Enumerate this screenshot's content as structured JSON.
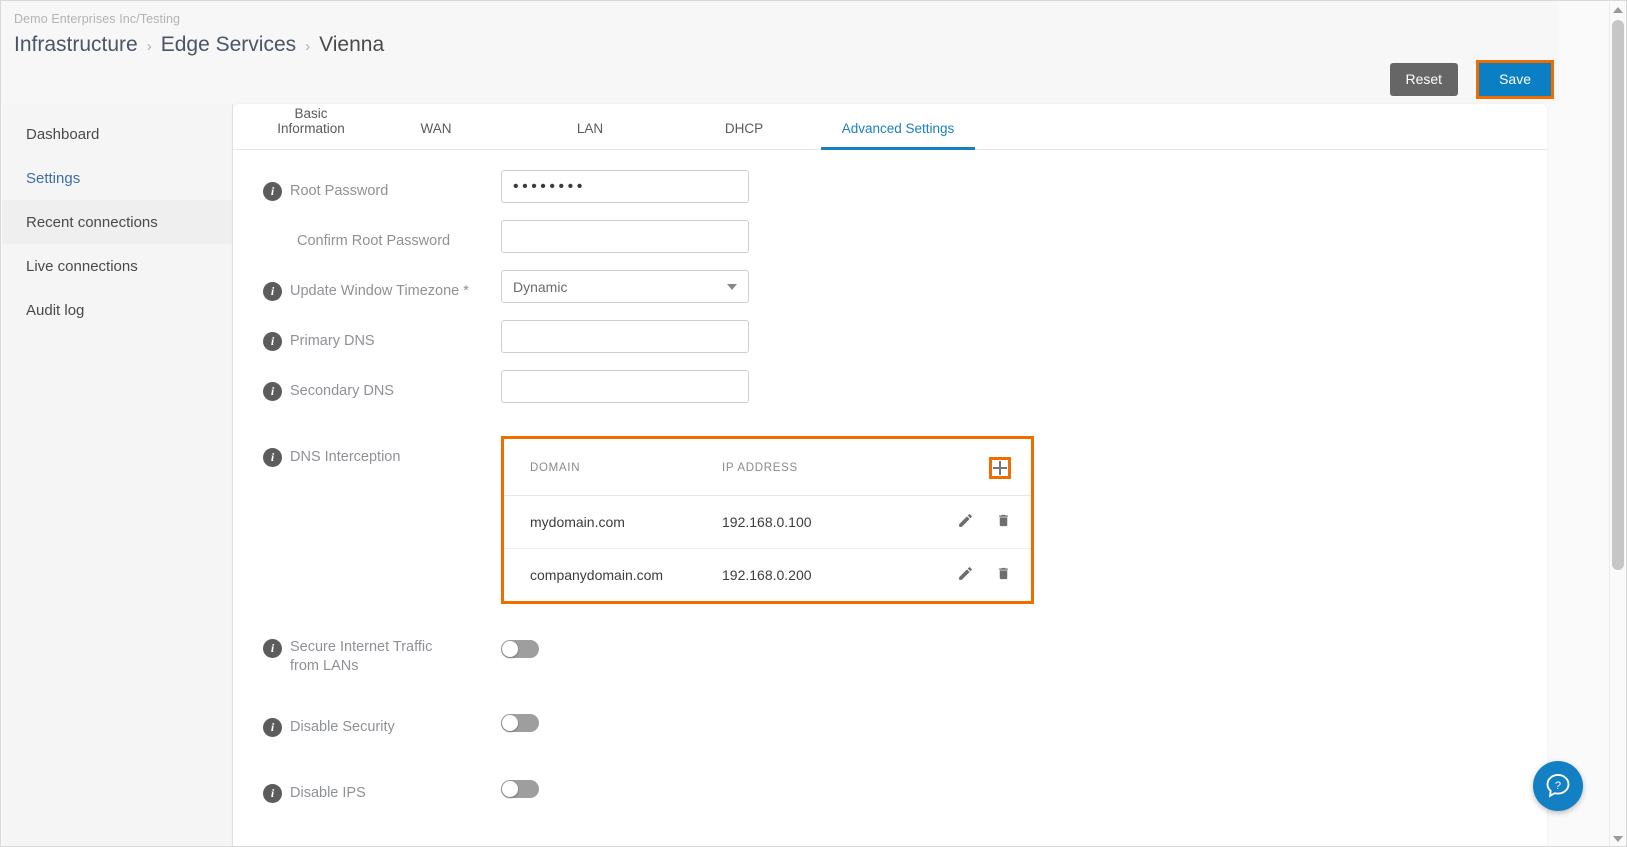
{
  "header": {
    "org": "Demo Enterprises Inc/Testing",
    "breadcrumb": [
      {
        "label": "Infrastructure",
        "type": "link"
      },
      {
        "label": "Edge Services",
        "type": "link"
      },
      {
        "label": "Vienna",
        "type": "current"
      }
    ],
    "separator": "›",
    "reset_label": "Reset",
    "save_label": "Save"
  },
  "sidebar": {
    "items": [
      {
        "label": "Dashboard",
        "state": "default"
      },
      {
        "label": "Settings",
        "state": "active-link"
      },
      {
        "label": "Recent connections",
        "state": "hovered"
      },
      {
        "label": "Live connections",
        "state": "default"
      },
      {
        "label": "Audit log",
        "state": "default"
      }
    ]
  },
  "tabs": [
    {
      "label": "Basic Information",
      "active": false
    },
    {
      "label": "WAN",
      "active": false
    },
    {
      "label": "LAN",
      "active": false
    },
    {
      "label": "DHCP",
      "active": false
    },
    {
      "label": "Advanced Settings",
      "active": true
    }
  ],
  "form": {
    "root_password": {
      "label": "Root Password",
      "value": "••••••••",
      "placeholder": ""
    },
    "confirm_root_password": {
      "label": "Confirm Root Password",
      "value": "",
      "placeholder": ""
    },
    "update_window_timezone": {
      "label": "Update Window Timezone *",
      "value": "Dynamic",
      "options": [
        "Dynamic"
      ]
    },
    "primary_dns": {
      "label": "Primary DNS",
      "value": "",
      "placeholder": ""
    },
    "secondary_dns": {
      "label": "Secondary DNS",
      "value": "",
      "placeholder": ""
    },
    "dns_interception": {
      "label": "DNS Interception",
      "columns": [
        "DOMAIN",
        "IP ADDRESS"
      ],
      "add_icon": "plus-icon",
      "rows": [
        {
          "domain": "mydomain.com",
          "ip": "192.168.0.100"
        },
        {
          "domain": "companydomain.com",
          "ip": "192.168.0.200"
        }
      ]
    },
    "secure_internet_traffic": {
      "label": "Secure Internet Traffic from LANs",
      "enabled": false
    },
    "disable_security": {
      "label": "Disable Security",
      "enabled": false
    },
    "disable_ips": {
      "label": "Disable IPS",
      "enabled": false
    }
  },
  "help": {
    "icon": "question-bubble-icon"
  },
  "colors": {
    "accent_blue": "#1a7fc1",
    "highlight_orange": "#ef6c00",
    "reset_gray": "#666666",
    "label_gray": "#8e9196"
  }
}
